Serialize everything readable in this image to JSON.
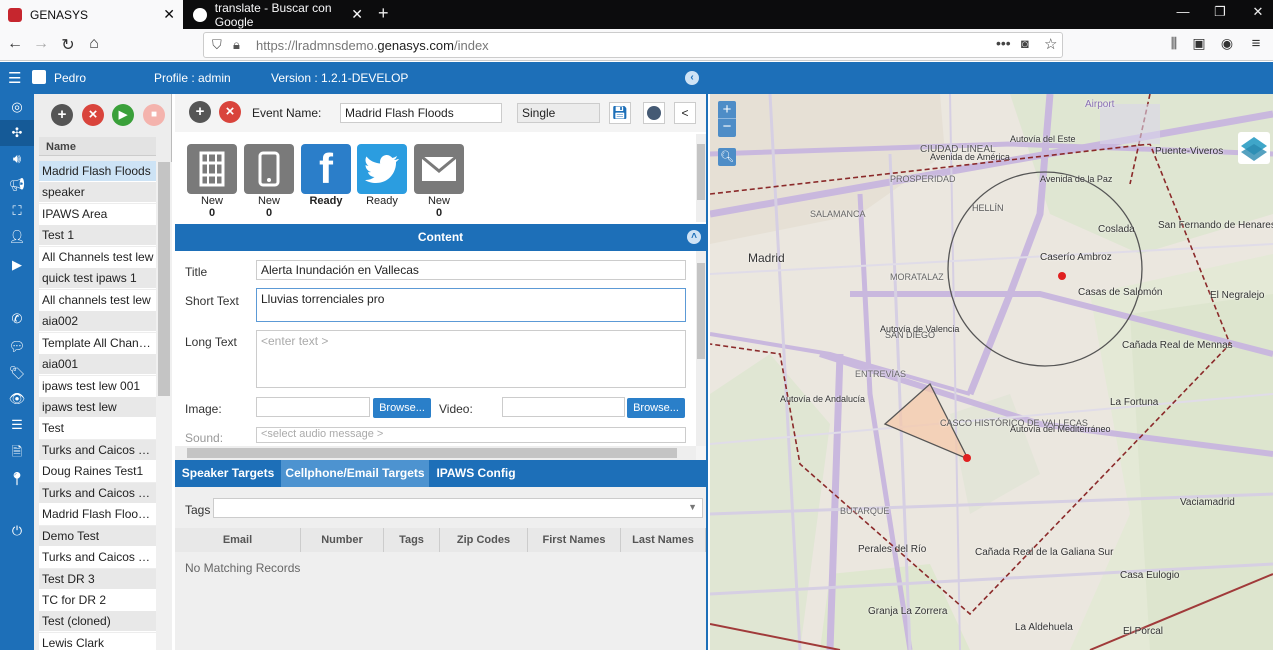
{
  "browser": {
    "tabs": [
      {
        "title": "GENASYS",
        "active": true
      },
      {
        "title": "translate - Buscar con Google",
        "active": false
      }
    ],
    "new_tab": "+",
    "url_prefix": "https://lradmnsdemo.",
    "url_domain": "genasys.com",
    "url_path": "/index"
  },
  "header": {
    "user": "Pedro",
    "profile": "Profile : admin",
    "version": "Version : 1.2.1-DEVELOP"
  },
  "event_list": {
    "column_header": "Name",
    "items": [
      "Madrid Flash Floods",
      "speaker",
      "IPAWS Area",
      "Test 1",
      "All Channels test lew",
      "quick test ipaws 1",
      "All channels test lew",
      "aia002",
      "Template All Channels",
      "aia001",
      "ipaws test lew 001",
      "ipaws test lew",
      "Test",
      "Turks and Caicos Test",
      "Doug Raines Test1",
      "Turks and Caicos Test",
      "Madrid Flash Flood Template",
      "Demo Test",
      "Turks and Caicos Test",
      "Test DR 3",
      "TC for DR 2",
      "Test (cloned)",
      "Lewis Clark"
    ],
    "selected_index": 0
  },
  "editor": {
    "event_name_label": "Event Name:",
    "event_name_value": "Madrid Flash Floods",
    "mode_value": "Single",
    "collapse_label": "<",
    "channels": [
      {
        "icon": "speaker-icon",
        "label": "New",
        "count": "0",
        "color": "#7a7a7a"
      },
      {
        "icon": "phone-icon",
        "label": "New",
        "count": "0",
        "color": "#7a7a7a"
      },
      {
        "icon": "facebook-icon",
        "label": "Ready",
        "count": "",
        "color": "#2b7ec9"
      },
      {
        "icon": "twitter-icon",
        "label": "Ready",
        "count": "",
        "color": "#2b9de0"
      },
      {
        "icon": "email-icon",
        "label": "New",
        "count": "0",
        "color": "#7a7a7a"
      }
    ],
    "content_title": "Content",
    "fields": {
      "title_label": "Title",
      "title_value": "Alerta Inundación en Vallecas",
      "short_label": "Short Text",
      "short_value": "Lluvias torrenciales pro",
      "long_label": "Long Text",
      "long_placeholder": "<enter text >",
      "image_label": "Image:",
      "video_label": "Video:",
      "browse_label": "Browse...",
      "sound_label": "Sound:",
      "sound_placeholder": "<select audio message >"
    },
    "target_tabs": [
      "Speaker Targets",
      "Cellphone/Email Targets",
      "IPAWS Config"
    ],
    "active_target_tab": 1,
    "tags_label": "Tags",
    "table_headers": [
      "Email",
      "Number",
      "Tags",
      "Zip Codes",
      "First Names",
      "Last Names"
    ],
    "empty_text": "No Matching Records"
  },
  "map": {
    "labels": [
      "Airport",
      "CIUDAD LINEAL",
      "PROSPERIDAD",
      "SALAMANCA",
      "Madrid",
      "HELLÍN",
      "Caserío Ambroz",
      "Coslada",
      "San Fernando de Henares",
      "Casas de Salomón",
      "El Negralejo",
      "MORATALAZ",
      "SAN DIEGO",
      "ENTREVÍAS",
      "CASCO HISTÓRICO DE VALLECAS",
      "La Fortuna",
      "Cañada Real de Mennas",
      "BUTARQUE",
      "Perales del Río",
      "Cañada Real de la Galiana Sur",
      "Casa Eulogio",
      "Granja La Zorrera",
      "La Aldehuela",
      "El Porcal",
      "Vaciamadrid",
      "Puente-Viveros",
      "Avenida de América",
      "Autovía del Este",
      "Autovía de Andalucía",
      "Autovía del Mediterráneo",
      "Autovía de Valencia",
      "Avenida de la Paz"
    ]
  }
}
